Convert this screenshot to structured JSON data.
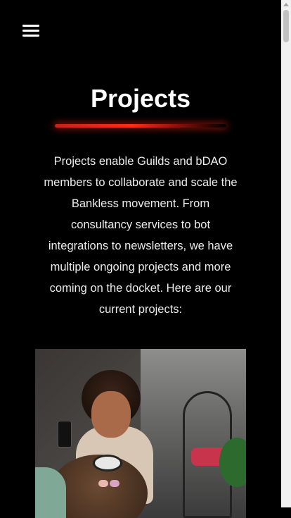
{
  "header": {
    "menu_icon": "hamburger-menu-icon"
  },
  "main": {
    "title": "Projects",
    "intro": "Projects enable Guilds and bDAO members to collaborate and scale the Bankless movement. From consultancy services to bot integrations to newsletters, we have multiple ongoing projects and more coming on the docket. Here are our current projects:"
  },
  "colors": {
    "background": "#000000",
    "text": "#ffffff",
    "accent": "#ff2a1a"
  }
}
